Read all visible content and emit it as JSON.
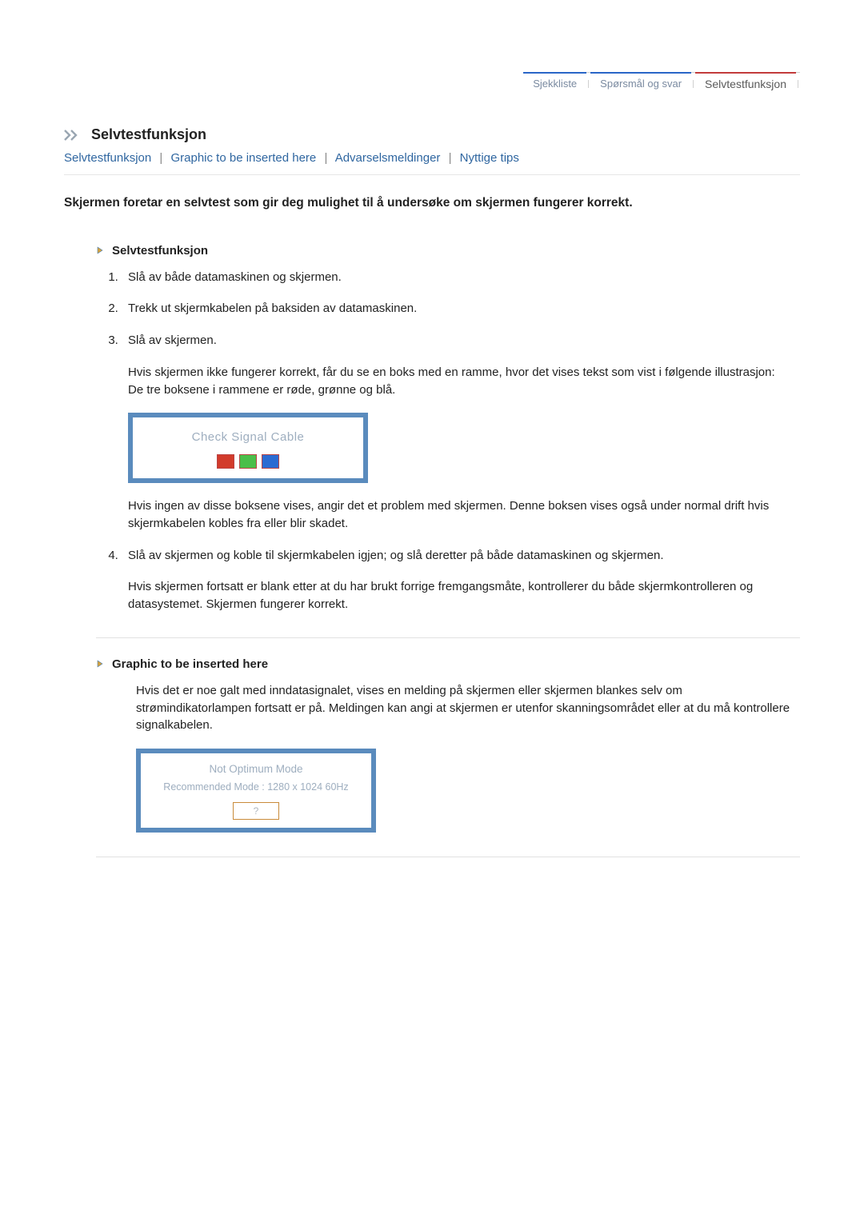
{
  "topnav": {
    "tabs": [
      {
        "label": "Sjekkliste",
        "accent": "blue",
        "active": false
      },
      {
        "label": "Spørsmål og svar",
        "accent": "blue",
        "active": false
      },
      {
        "label": "Selvtestfunksjon",
        "accent": "red",
        "active": true
      }
    ]
  },
  "title": "Selvtestfunksjon",
  "anchors": [
    "Selvtestfunksjon",
    "Graphic to be inserted here",
    "Advarselsmeldinger",
    "Nyttige tips"
  ],
  "intro": "Skjermen foretar en selvtest som gir deg mulighet til å undersøke om skjermen fungerer korrekt.",
  "section1": {
    "heading": "Selvtestfunksjon",
    "steps": {
      "s1": "Slå av både datamaskinen og skjermen.",
      "s2": "Trekk ut skjermkabelen på baksiden av datamaskinen.",
      "s3": "Slå av skjermen.",
      "s3_p1": "Hvis skjermen ikke fungerer korrekt, får du se en boks med en ramme, hvor det vises tekst som vist i følgende illustrasjon:",
      "s3_p2": "De tre boksene i rammene er røde, grønne og blå.",
      "monitor1_msg": "Check Signal Cable",
      "s3_after": "Hvis ingen av disse boksene vises, angir det et problem med skjermen. Denne boksen vises også under normal drift hvis skjermkabelen kobles fra eller blir skadet.",
      "s4": "Slå av skjermen og koble til skjermkabelen igjen; og slå deretter på både datamaskinen og skjermen.",
      "s4_p1": "Hvis skjermen fortsatt er blank etter at du har brukt forrige fremgangsmåte, kontrollerer du både skjermkontrolleren og datasystemet. Skjermen fungerer korrekt."
    }
  },
  "section2": {
    "heading": "Graphic to be inserted here",
    "para": "Hvis det er noe galt med inndatasignalet, vises en melding på skjermen eller skjermen blankes selv om strømindikatorlampen fortsatt er på. Meldingen kan angi at skjermen er utenfor skanningsområdet eller at du må kontrollere signalkabelen.",
    "monitor2_line1": "Not Optimum Mode",
    "monitor2_line2": "Recommended Mode : 1280 x 1024  60Hz",
    "monitor2_btn": "?"
  },
  "colors": {
    "link": "#2f66a0",
    "nav_text": "#7a8aa0",
    "accent_blue": "#2a66c7",
    "accent_red": "#c23b3b",
    "monitor_frame": "#5a8bbd",
    "swatch_red": "#d23b2b",
    "swatch_green": "#4abf4a",
    "swatch_blue": "#2b6bd2"
  }
}
